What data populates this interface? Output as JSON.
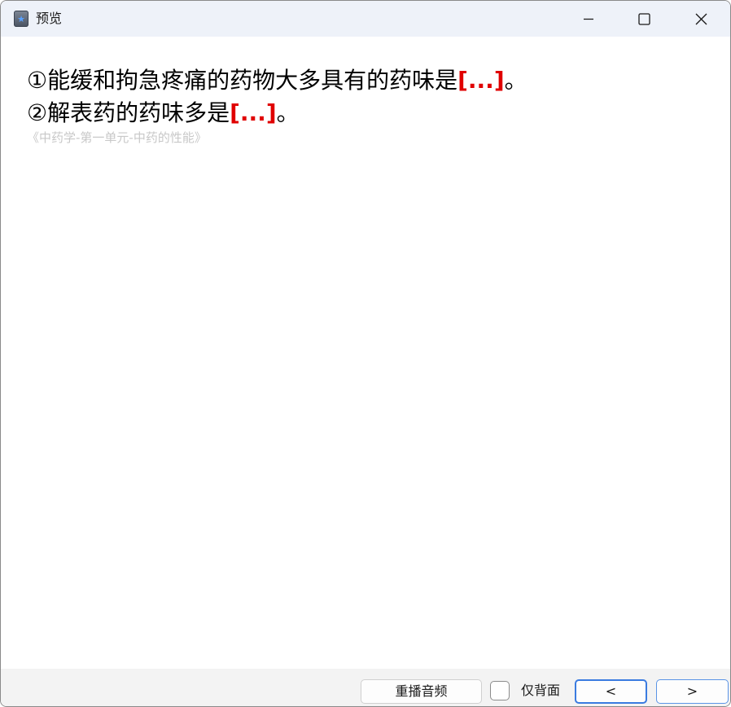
{
  "window": {
    "title": "预览",
    "app_icon": "app-star-icon",
    "controls": [
      "minimize-icon",
      "maximize-icon",
      "close-icon"
    ]
  },
  "card": {
    "line1": {
      "text": "①能缓和拘急疼痛的药物大多具有的药味是",
      "cloze": "[...]",
      "suffix": "。"
    },
    "line2": {
      "text": "②解表药的药味多是",
      "cloze": "[...]",
      "suffix": "。"
    },
    "source": "《中药学-第一单元-中药的性能》"
  },
  "footer": {
    "replay_label": "重播音频",
    "back_only_label": "仅背面",
    "back_only_checked": false,
    "prev_label": "<",
    "next_label": ">"
  },
  "colors": {
    "cloze": "#e00000",
    "titlebar": "#eef2f9",
    "accent": "#3a7be0",
    "source_text": "#c8c8c8"
  }
}
